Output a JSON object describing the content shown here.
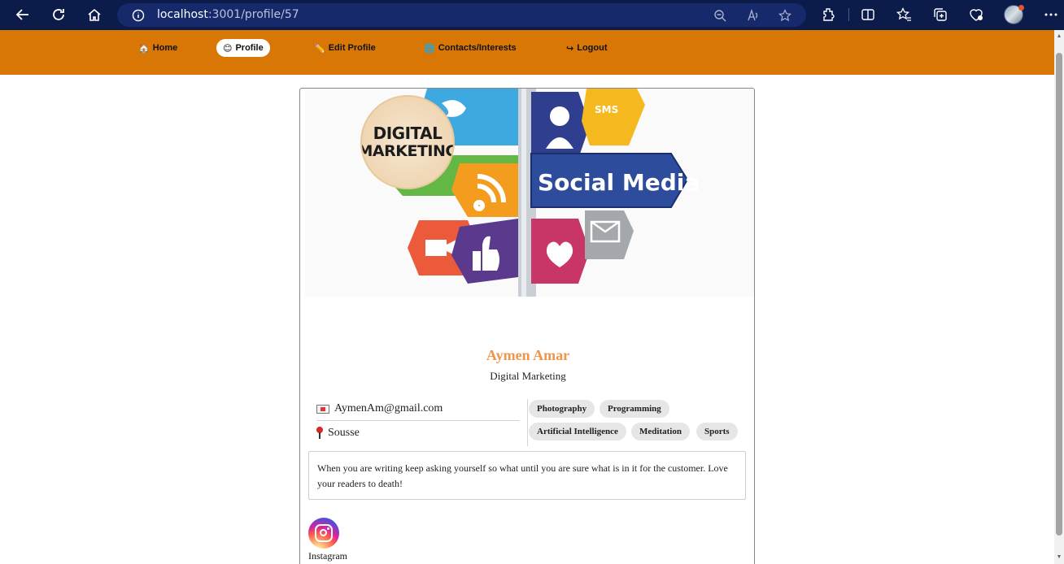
{
  "browser": {
    "url_host": "localhost",
    "url_path": ":3001/profile/57"
  },
  "nav": {
    "items": [
      {
        "icon": "🏠",
        "label": "Home"
      },
      {
        "icon": "😊",
        "label": "Profile"
      },
      {
        "icon": "✏️",
        "label": "Edit Profile"
      },
      {
        "icon": "🌐",
        "label": "Contacts/Interests"
      },
      {
        "icon": "↪",
        "label": "Logout"
      }
    ],
    "active": "Profile",
    "bar_color": "#d97706"
  },
  "profile": {
    "picture_text_line1": "DIGITAL",
    "picture_text_line2": "MARKETING",
    "cover_sign_text": "Social Media",
    "cover_sign_sms": "SMS",
    "name": "Aymen Amar",
    "headline": "Digital Marketing",
    "email": "AymenAm@gmail.com",
    "location": "Sousse",
    "interests": [
      "Photography",
      "Programming",
      "Artificial Intelligence",
      "Meditation",
      "Sports"
    ],
    "bio": "When you are writing keep asking yourself so what until you are sure what is in it for the customer. Love your readers to death!",
    "social_label": "Instagram",
    "name_color": "#f0944a"
  }
}
